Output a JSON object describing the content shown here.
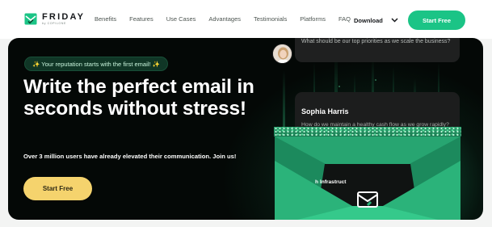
{
  "brand": {
    "name": "FRIDAY",
    "sub": "by COPILONE",
    "accent": "#1bc486",
    "cta_yellow": "#f5d36d"
  },
  "nav": {
    "items": [
      "Benefits",
      "Features",
      "Use Cases",
      "Advantages",
      "Testimonials",
      "Platforms",
      "FAQ"
    ],
    "download_label": "Download",
    "cta_label": "Start Free"
  },
  "hero": {
    "badge": "✨ Your reputation starts with the first email! ✨",
    "headline": "Write the perfect email in seconds without stress!",
    "subline": "Over 3 million users have already elevated their communication. Join us!",
    "cta_label": "Start Free"
  },
  "cards": {
    "top_question": "What should be our top priorities as we scale the business?",
    "mid_name": "Sophia Harris",
    "mid_question": "How do we maintain a healthy cash flow as we grow rapidly?",
    "envelope_text": "h Infrastruct"
  },
  "icons": {
    "logo": "mail-check-logo-icon",
    "download_chevron": "chevron-down-icon",
    "envelope_mark": "mail-check-icon"
  }
}
